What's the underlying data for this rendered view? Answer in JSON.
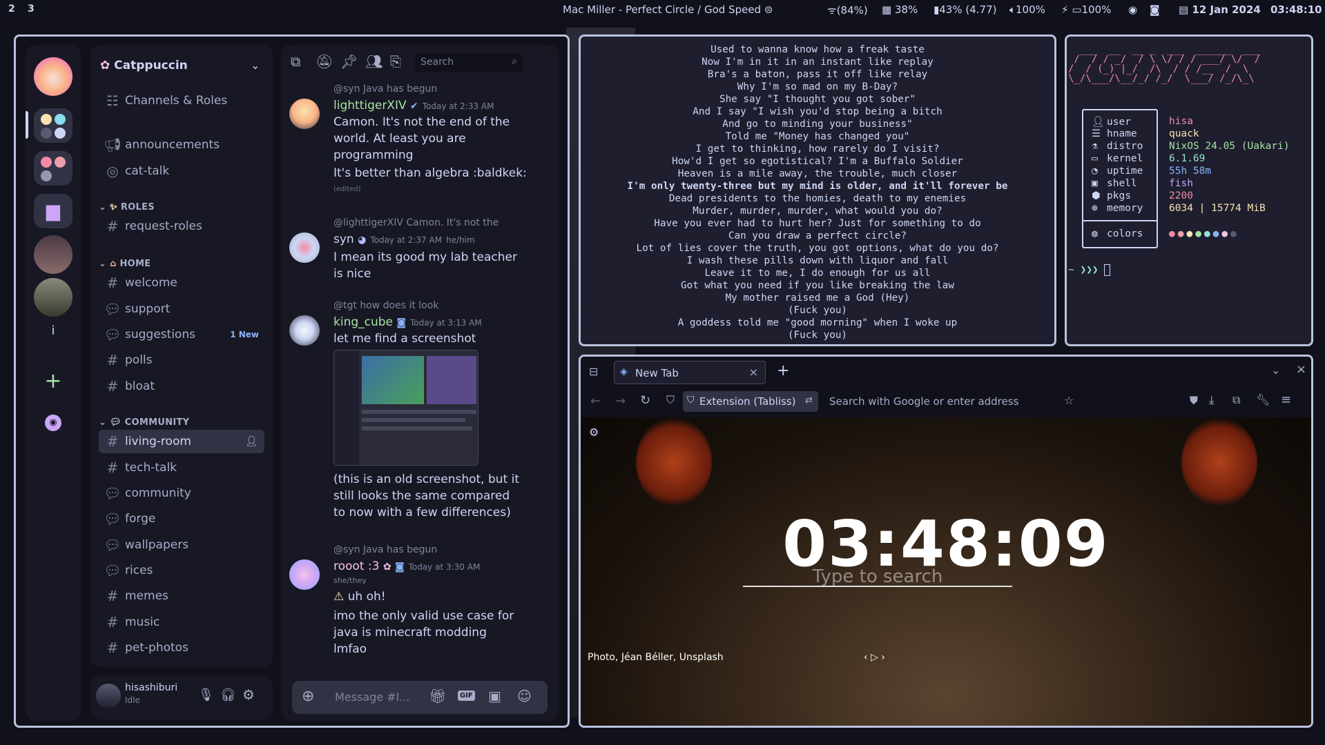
{
  "topbar": {
    "workspaces": [
      "2",
      "3"
    ],
    "media": "Mac Miller - Perfect Circle / God Speed",
    "wifi": "(84%)",
    "cpu": "38%",
    "battery": "43% (4.77)",
    "volume": "100%",
    "brightness": "100%",
    "date": "12 Jan 2024",
    "time": "03:48:10"
  },
  "discord": {
    "server_name": "Catppuccin",
    "channels_roles": "Channels & Roles",
    "channels_top": [
      "announcements",
      "cat-talk"
    ],
    "cat_roles": "ROLES",
    "request_roles": "request-roles",
    "cat_home": "HOME",
    "home_channels": [
      "welcome",
      "support",
      "suggestions",
      "polls",
      "bloat"
    ],
    "suggestions_badge": "1 New",
    "cat_community": "COMMUNITY",
    "community_channels": [
      "living-room",
      "tech-talk",
      "community",
      "forge",
      "wallpapers",
      "rices",
      "memes",
      "music",
      "pet-photos"
    ],
    "user": {
      "name": "hisashiburi",
      "status": "Idle"
    },
    "guild_letter": "i",
    "search_placeholder": "Search",
    "composer_placeholder": "Message #l...",
    "messages": [
      {
        "reply": "@syn Java has begun",
        "name": "lighttigerXIV",
        "time": "Today at 2:33 AM",
        "lines": [
          "Camon. It's not the end of the world. At least you are programming"
        ],
        "extra": "It's better than algebra :baldkek:",
        "edited": "(edited)"
      },
      {
        "reply": "@lighttigerXIV Camon. It's not the",
        "name": "syn",
        "time": "Today at 2:37 AM",
        "pronoun": "he/him",
        "lines": [
          "I mean its good my lab teacher is nice"
        ]
      },
      {
        "reply": "@tgt how does it look",
        "name": "king_cube",
        "time": "Today at 3:13 AM",
        "lines": [
          "let me find a screenshot"
        ],
        "after": "(this is an old screenshot, but it still looks the same compared to now with a few differences)"
      },
      {
        "reply": "@syn Java has begun",
        "name": "rooot :3",
        "time": "Today at 3:30 AM",
        "pronoun": "she/they",
        "warn": "uh oh!",
        "lines": [
          "imo the only valid use case for java is minecraft modding lmfao"
        ]
      }
    ]
  },
  "lyrics": [
    "Used to wanna know how a freak taste",
    "Now I'm in it in an instant like replay",
    "Bra's a baton, pass it off like relay",
    "Why I'm so mad on my B-Day?",
    "She say \"I thought you got sober\"",
    "And I say \"I wish you'd stop being a bitch",
    "And go to minding your business\"",
    "Told me \"Money has changed you\"",
    "I get to thinking, how rarely do I visit?",
    "How'd I get so egotistical? I'm a Buffalo Soldier",
    "Heaven is a mile away, the trouble, much closer",
    "I'm only twenty-three but my mind is older, and it'll forever be",
    "Dead presidents to the homies, death to my enemies",
    "Murder, murder, murder, what would you do?",
    "Have you ever had to hurt her? Just for something to do",
    "Can you draw a perfect circle?",
    "Lot of lies cover the truth, you got options, what do you do?",
    "I wash these pills down with liquor and fall",
    "Leave it to me, I do enough for us all",
    "Got what you need if you like breaking the law",
    "My mother raised me a God (Hey)",
    "(Fuck you)",
    "A goddess told me \"good morning\" when I woke up",
    "(Fuck you)"
  ],
  "lyrics_bold_index": 11,
  "fetch": {
    "ascii": "  ___  __  __ _  ___  ______  ___\n /  / / _/  / \\ \\/ / / ___/ \\/  /\n/  / (_) |_/  /\\  / / /__  /  \\ \n\\_/\\___/\\__/_/ /_/  \\___/ /_/\\_\\ ",
    "rows": [
      {
        "k": "user",
        "v": "hisa",
        "c": "#f38ba8"
      },
      {
        "k": "hname",
        "v": "quack",
        "c": "#f9e2af"
      },
      {
        "k": "distro",
        "v": "NixOS 24.05 (Uakari)",
        "c": "#a6e3a1"
      },
      {
        "k": "kernel",
        "v": "6.1.69",
        "c": "#94e2d5"
      },
      {
        "k": "uptime",
        "v": "55h 58m",
        "c": "#89b4fa"
      },
      {
        "k": "shell",
        "v": "fish",
        "c": "#cba6f7"
      },
      {
        "k": "pkgs",
        "v": "2200",
        "c": "#f38ba8"
      },
      {
        "k": "memory",
        "v": "6034 | 15774 MiB",
        "c": "#f9e2af"
      }
    ],
    "colors_label": "colors",
    "prompt": "~ ❯❯❯"
  },
  "firefox": {
    "tab_title": "New Tab",
    "extension_label": "Extension (Tabliss)",
    "url_placeholder": "Search with Google or enter address",
    "clock": "03:48:09",
    "search_hint": "Type to search",
    "photo_credit": "Photo, Jéan Béller, Unsplash"
  }
}
